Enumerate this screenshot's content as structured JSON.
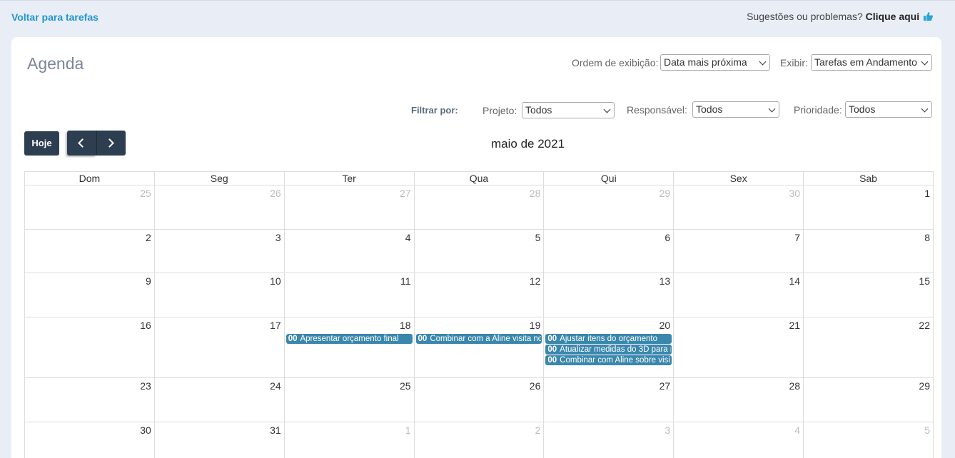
{
  "header": {
    "back_link": "Voltar para tarefas",
    "suggest_text": "Sugestões ou problemas?",
    "suggest_link": "Clique aqui"
  },
  "page": {
    "title": "Agenda",
    "order_label": "Ordem de exibição:",
    "order_value": "Data mais próxima",
    "show_label": "Exibir:",
    "show_value": "Tarefas em Andamento"
  },
  "filters": {
    "label": "Filtrar por:",
    "project_label": "Projeto:",
    "project_value": "Todos",
    "responsible_label": "Responsável:",
    "responsible_value": "Todos",
    "priority_label": "Prioridade:",
    "priority_value": "Todos"
  },
  "toolbar": {
    "today_label": "Hoje",
    "month_title": "maio de 2021"
  },
  "calendar": {
    "weekdays": [
      "Dom",
      "Seg",
      "Ter",
      "Qua",
      "Qui",
      "Sex",
      "Sab"
    ],
    "weeks": [
      [
        {
          "d": "25",
          "o": true
        },
        {
          "d": "26",
          "o": true
        },
        {
          "d": "27",
          "o": true
        },
        {
          "d": "28",
          "o": true
        },
        {
          "d": "29",
          "o": true
        },
        {
          "d": "30",
          "o": true
        },
        {
          "d": "1",
          "o": false
        }
      ],
      [
        {
          "d": "2",
          "o": false
        },
        {
          "d": "3",
          "o": false
        },
        {
          "d": "4",
          "o": false
        },
        {
          "d": "5",
          "o": false
        },
        {
          "d": "6",
          "o": false
        },
        {
          "d": "7",
          "o": false
        },
        {
          "d": "8",
          "o": false
        }
      ],
      [
        {
          "d": "9",
          "o": false
        },
        {
          "d": "10",
          "o": false
        },
        {
          "d": "11",
          "o": false
        },
        {
          "d": "12",
          "o": false
        },
        {
          "d": "13",
          "o": false
        },
        {
          "d": "14",
          "o": false
        },
        {
          "d": "15",
          "o": false
        }
      ],
      [
        {
          "d": "16",
          "o": false
        },
        {
          "d": "17",
          "o": false
        },
        {
          "d": "18",
          "o": false,
          "events": [
            {
              "time": "00",
              "title": "Apresentar orçamento final"
            }
          ]
        },
        {
          "d": "19",
          "o": false,
          "events": [
            {
              "time": "00",
              "title": "Combinar com a Aline visita no"
            }
          ]
        },
        {
          "d": "20",
          "o": false,
          "events": [
            {
              "time": "00",
              "title": "Ajustar itens do orçamento"
            },
            {
              "time": "00",
              "title": "Atualizar medidas do 3D para r"
            },
            {
              "time": "00",
              "title": "Combinar com Aline sobre visi"
            }
          ]
        },
        {
          "d": "21",
          "o": false
        },
        {
          "d": "22",
          "o": false
        }
      ],
      [
        {
          "d": "23",
          "o": false
        },
        {
          "d": "24",
          "o": false
        },
        {
          "d": "25",
          "o": false
        },
        {
          "d": "26",
          "o": false
        },
        {
          "d": "27",
          "o": false
        },
        {
          "d": "28",
          "o": false
        },
        {
          "d": "29",
          "o": false
        }
      ],
      [
        {
          "d": "30",
          "o": false
        },
        {
          "d": "31",
          "o": false
        },
        {
          "d": "1",
          "o": true
        },
        {
          "d": "2",
          "o": true
        },
        {
          "d": "3",
          "o": true
        },
        {
          "d": "4",
          "o": true
        },
        {
          "d": "5",
          "o": true
        }
      ]
    ]
  },
  "colors": {
    "accent_link": "#2196d3",
    "button_dark": "#2c3e50",
    "event_bg": "#3a87ad",
    "thumb_icon": "#26a5d6"
  }
}
